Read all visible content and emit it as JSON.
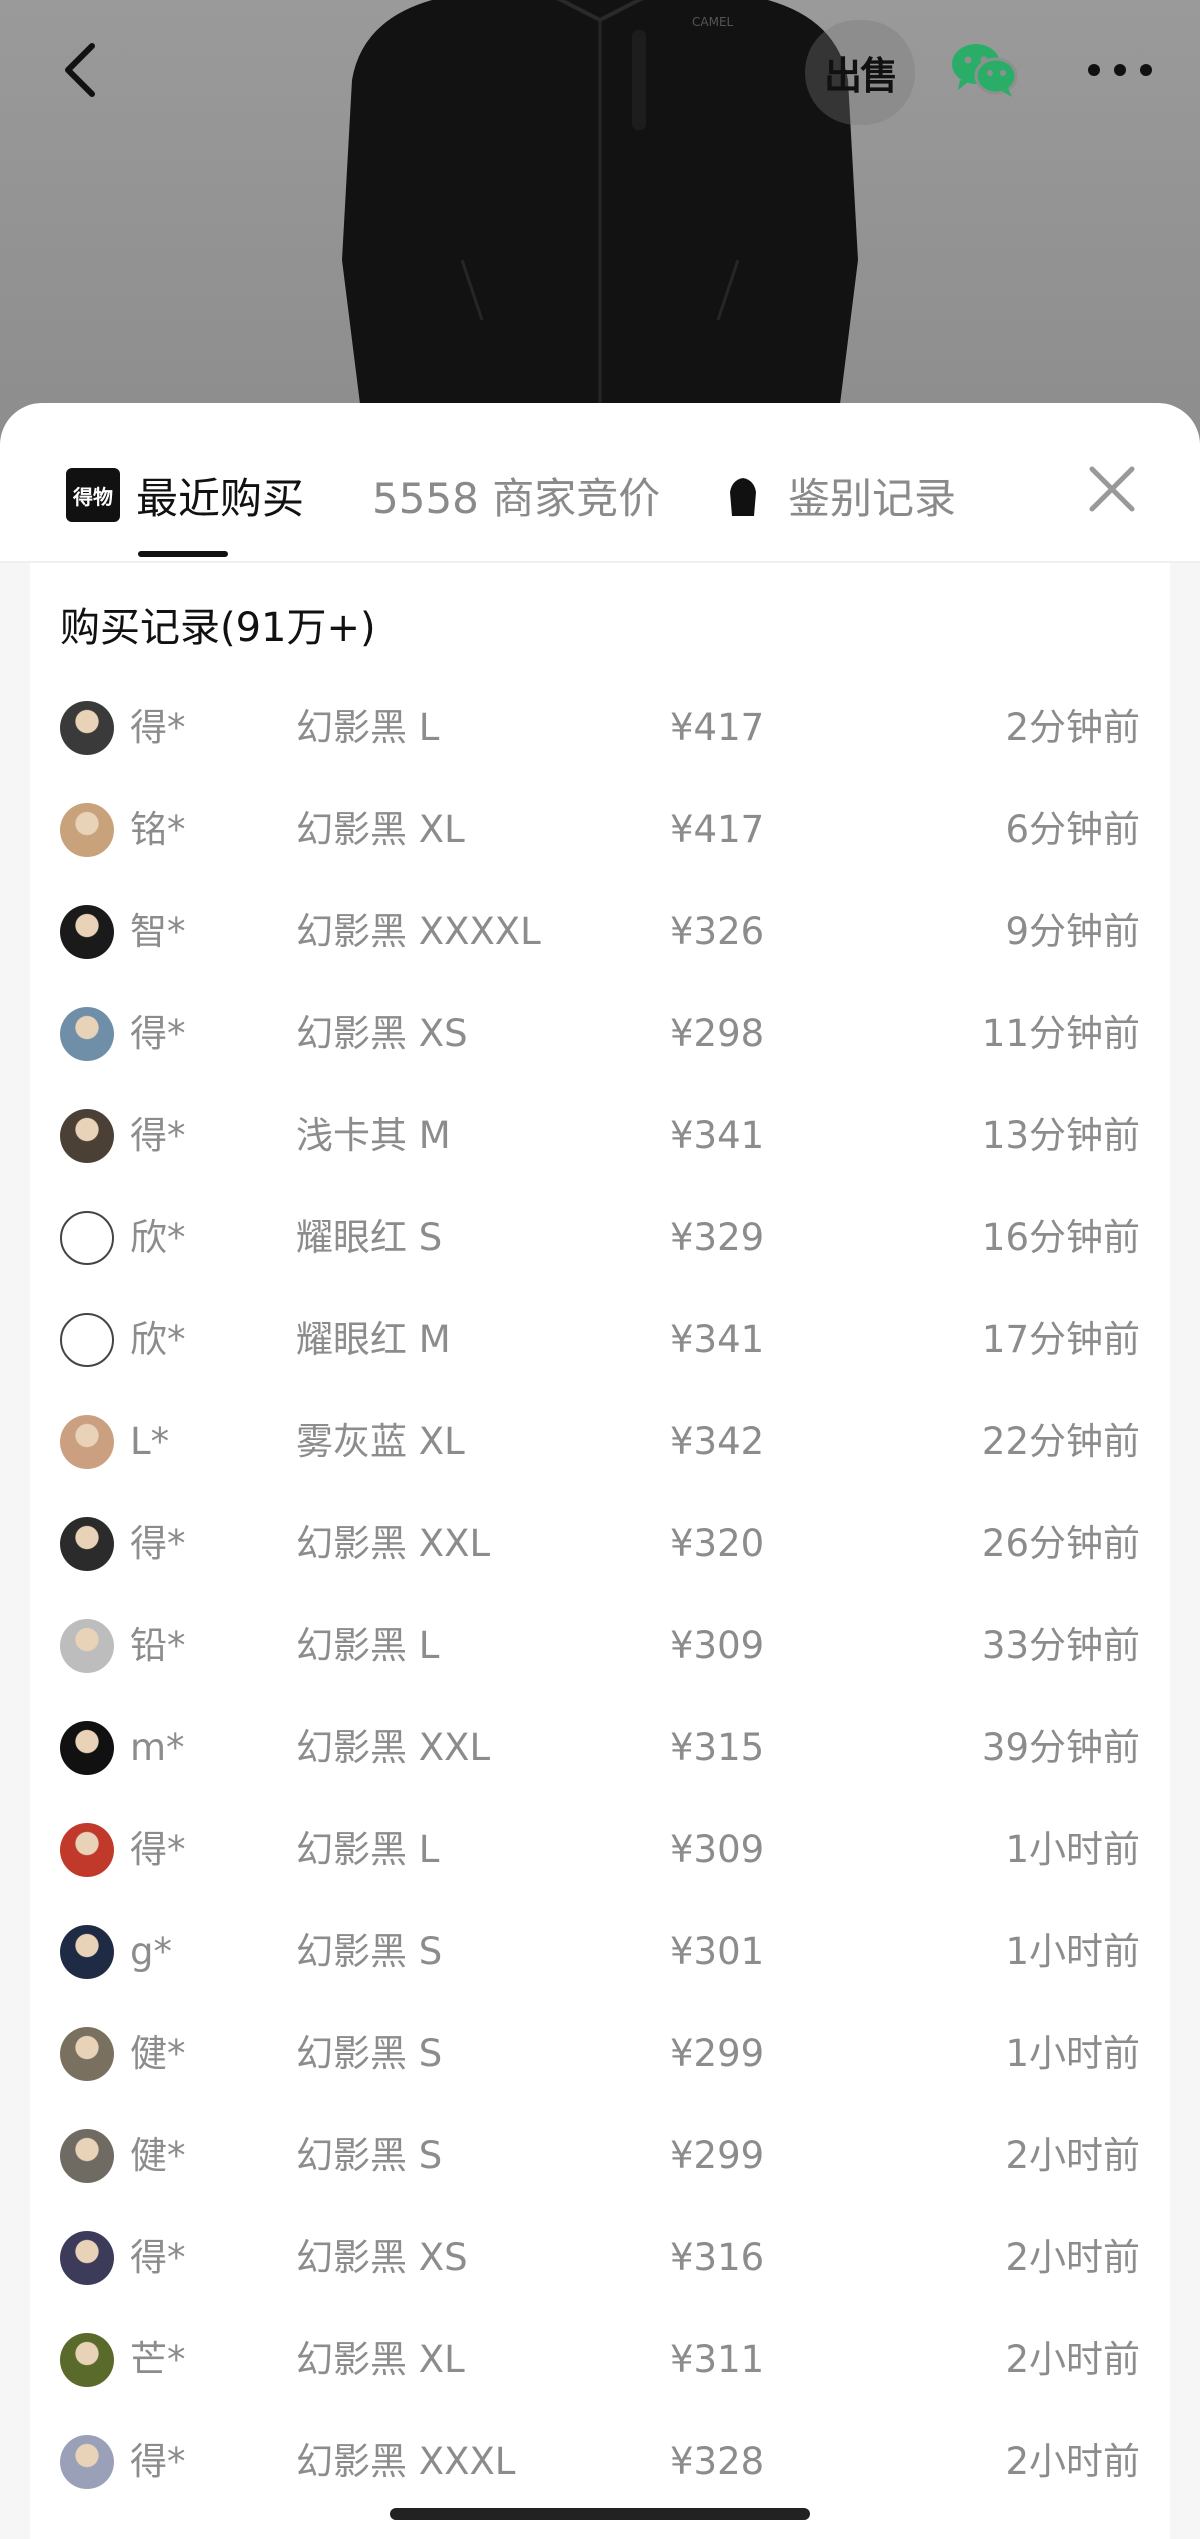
{
  "header": {
    "sell_label": "出售",
    "jacket_brand": "CAMEL"
  },
  "tabs": {
    "recent": {
      "logo": "得物",
      "label": "最近购买"
    },
    "bids": {
      "label": "5558 商家竞价"
    },
    "auth": {
      "label": "鉴别记录"
    }
  },
  "panel": {
    "title": "购买记录(91万+)"
  },
  "colors": {
    "avatars": [
      "#3a3a3a",
      "#c8a27a",
      "#1a1a1a",
      "#6f8fa8",
      "#4a4036",
      "#ffffff",
      "#ffffff",
      "#caa080",
      "#2b2b2b",
      "#bdbdbd",
      "#111111",
      "#c0392b",
      "#1f2a44",
      "#7a7060",
      "#6f6a62",
      "#3c3c5a",
      "#5a6a2a",
      "#9aa0b8"
    ]
  },
  "records": [
    {
      "user": "得*",
      "product": "幻影黑 L",
      "price": "¥417",
      "time": "2分钟前"
    },
    {
      "user": "铭*",
      "product": "幻影黑 XL",
      "price": "¥417",
      "time": "6分钟前"
    },
    {
      "user": "智*",
      "product": "幻影黑 XXXXL",
      "price": "¥326",
      "time": "9分钟前"
    },
    {
      "user": "得*",
      "product": "幻影黑 XS",
      "price": "¥298",
      "time": "11分钟前"
    },
    {
      "user": "得*",
      "product": "浅卡其 M",
      "price": "¥341",
      "time": "13分钟前"
    },
    {
      "user": "欣*",
      "product": "耀眼红 S",
      "price": "¥329",
      "time": "16分钟前"
    },
    {
      "user": "欣*",
      "product": "耀眼红 M",
      "price": "¥341",
      "time": "17分钟前"
    },
    {
      "user": "L*",
      "product": "雾灰蓝 XL",
      "price": "¥342",
      "time": "22分钟前"
    },
    {
      "user": "得*",
      "product": "幻影黑 XXL",
      "price": "¥320",
      "time": "26分钟前"
    },
    {
      "user": "铅*",
      "product": "幻影黑 L",
      "price": "¥309",
      "time": "33分钟前"
    },
    {
      "user": "m*",
      "product": "幻影黑 XXL",
      "price": "¥315",
      "time": "39分钟前"
    },
    {
      "user": "得*",
      "product": "幻影黑 L",
      "price": "¥309",
      "time": "1小时前"
    },
    {
      "user": "g*",
      "product": "幻影黑 S",
      "price": "¥301",
      "time": "1小时前"
    },
    {
      "user": "健*",
      "product": "幻影黑 S",
      "price": "¥299",
      "time": "1小时前"
    },
    {
      "user": "健*",
      "product": "幻影黑 S",
      "price": "¥299",
      "time": "2小时前"
    },
    {
      "user": "得*",
      "product": "幻影黑 XS",
      "price": "¥316",
      "time": "2小时前"
    },
    {
      "user": "芒*",
      "product": "幻影黑 XL",
      "price": "¥311",
      "time": "2小时前"
    },
    {
      "user": "得*",
      "product": "幻影黑 XXXL",
      "price": "¥328",
      "time": "2小时前"
    }
  ]
}
